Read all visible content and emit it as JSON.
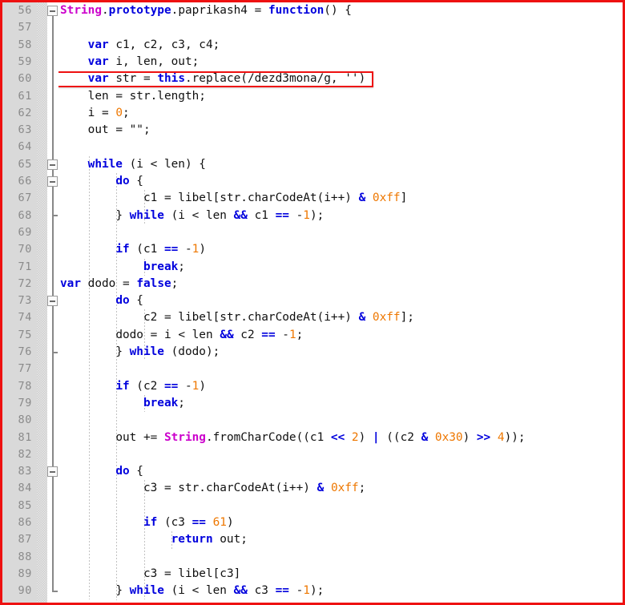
{
  "editor": {
    "language": "JavaScript",
    "first_line": 56,
    "last_line": 90,
    "line_height": 21.3,
    "colors": {
      "background": "#ffffff",
      "gutter_background": "#d9d9d9",
      "line_number": "#8a8a8a",
      "keyword": "#0000dd",
      "type": "#cc00cc",
      "number": "#ee7700",
      "text": "#101010",
      "highlight_border": "#ee1111",
      "fold_line": "#888888",
      "indent_guide": "#c2c2c2"
    },
    "highlight": {
      "line": 60,
      "text": "var str = this.replace(/dezd3mona/g, '')"
    },
    "fold_markers": [
      {
        "line": 56,
        "type": "open"
      },
      {
        "line": 65,
        "type": "open"
      },
      {
        "line": 66,
        "type": "open"
      },
      {
        "line": 68,
        "type": "end"
      },
      {
        "line": 73,
        "type": "open"
      },
      {
        "line": 76,
        "type": "end"
      },
      {
        "line": 83,
        "type": "open"
      },
      {
        "line": 90,
        "type": "end"
      }
    ],
    "line_numbers": [
      56,
      57,
      58,
      59,
      60,
      61,
      62,
      63,
      64,
      65,
      66,
      67,
      68,
      69,
      70,
      71,
      72,
      73,
      74,
      75,
      76,
      77,
      78,
      79,
      80,
      81,
      82,
      83,
      84,
      85,
      86,
      87,
      88,
      89,
      90
    ],
    "lines": [
      {
        "n": 56,
        "indent": 0,
        "tokens": [
          {
            "t": "String",
            "c": "typ"
          },
          {
            "t": ".",
            "c": "pun"
          },
          {
            "t": "prototype",
            "c": "kw"
          },
          {
            "t": ".",
            "c": "pun"
          },
          {
            "t": "paprikash4 ",
            "c": "pl"
          },
          {
            "t": "=",
            "c": "pun"
          },
          {
            "t": " ",
            "c": "pl"
          },
          {
            "t": "function",
            "c": "kw"
          },
          {
            "t": "() {",
            "c": "pun"
          }
        ]
      },
      {
        "n": 57,
        "indent": 0,
        "tokens": []
      },
      {
        "n": 58,
        "indent": 4,
        "tokens": [
          {
            "t": "var",
            "c": "kw"
          },
          {
            "t": " c1, c2, c3, c4;",
            "c": "pl"
          }
        ]
      },
      {
        "n": 59,
        "indent": 4,
        "tokens": [
          {
            "t": "var",
            "c": "kw"
          },
          {
            "t": " i, len, out;",
            "c": "pl"
          }
        ]
      },
      {
        "n": 60,
        "indent": 4,
        "tokens": [
          {
            "t": "var",
            "c": "kw"
          },
          {
            "t": " str ",
            "c": "pl"
          },
          {
            "t": "=",
            "c": "pun"
          },
          {
            "t": " ",
            "c": "pl"
          },
          {
            "t": "this",
            "c": "kw"
          },
          {
            "t": ".replace(/dezd3mona/g, '')",
            "c": "pl"
          }
        ]
      },
      {
        "n": 61,
        "indent": 4,
        "tokens": [
          {
            "t": "len ",
            "c": "pl"
          },
          {
            "t": "=",
            "c": "pun"
          },
          {
            "t": " str.length;",
            "c": "pl"
          }
        ]
      },
      {
        "n": 62,
        "indent": 4,
        "tokens": [
          {
            "t": "i ",
            "c": "pl"
          },
          {
            "t": "=",
            "c": "pun"
          },
          {
            "t": " ",
            "c": "pl"
          },
          {
            "t": "0",
            "c": "num"
          },
          {
            "t": ";",
            "c": "pun"
          }
        ]
      },
      {
        "n": 63,
        "indent": 4,
        "tokens": [
          {
            "t": "out ",
            "c": "pl"
          },
          {
            "t": "=",
            "c": "pun"
          },
          {
            "t": " \"\";",
            "c": "pl"
          }
        ]
      },
      {
        "n": 64,
        "indent": 0,
        "tokens": []
      },
      {
        "n": 65,
        "indent": 4,
        "tokens": [
          {
            "t": "while",
            "c": "kw"
          },
          {
            "t": " (i ",
            "c": "pl"
          },
          {
            "t": "<",
            "c": "pun"
          },
          {
            "t": " len) {",
            "c": "pl"
          }
        ]
      },
      {
        "n": 66,
        "indent": 8,
        "tokens": [
          {
            "t": "do",
            "c": "kw"
          },
          {
            "t": " {",
            "c": "pun"
          }
        ]
      },
      {
        "n": 67,
        "indent": 12,
        "tokens": [
          {
            "t": "c1 ",
            "c": "pl"
          },
          {
            "t": "=",
            "c": "pun"
          },
          {
            "t": " libel[str.charCodeAt(i++) ",
            "c": "pl"
          },
          {
            "t": "&",
            "c": "op"
          },
          {
            "t": " ",
            "c": "pl"
          },
          {
            "t": "0xff",
            "c": "num"
          },
          {
            "t": "]",
            "c": "pun"
          }
        ]
      },
      {
        "n": 68,
        "indent": 8,
        "tokens": [
          {
            "t": "} ",
            "c": "pun"
          },
          {
            "t": "while",
            "c": "kw"
          },
          {
            "t": " (i ",
            "c": "pl"
          },
          {
            "t": "<",
            "c": "pun"
          },
          {
            "t": " len ",
            "c": "pl"
          },
          {
            "t": "&&",
            "c": "op"
          },
          {
            "t": " c1 ",
            "c": "pl"
          },
          {
            "t": "==",
            "c": "op"
          },
          {
            "t": " ",
            "c": "pl"
          },
          {
            "t": "-",
            "c": "pun"
          },
          {
            "t": "1",
            "c": "num"
          },
          {
            "t": ");",
            "c": "pun"
          }
        ]
      },
      {
        "n": 69,
        "indent": 0,
        "tokens": []
      },
      {
        "n": 70,
        "indent": 8,
        "tokens": [
          {
            "t": "if",
            "c": "kw"
          },
          {
            "t": " (c1 ",
            "c": "pl"
          },
          {
            "t": "==",
            "c": "op"
          },
          {
            "t": " ",
            "c": "pl"
          },
          {
            "t": "-",
            "c": "pun"
          },
          {
            "t": "1",
            "c": "num"
          },
          {
            "t": ")",
            "c": "pun"
          }
        ]
      },
      {
        "n": 71,
        "indent": 12,
        "tokens": [
          {
            "t": "break",
            "c": "kw"
          },
          {
            "t": ";",
            "c": "pun"
          }
        ]
      },
      {
        "n": 72,
        "indent": 0,
        "tokens": [
          {
            "t": "var",
            "c": "kw"
          },
          {
            "t": " dodo ",
            "c": "pl"
          },
          {
            "t": "=",
            "c": "pun"
          },
          {
            "t": " ",
            "c": "pl"
          },
          {
            "t": "false",
            "c": "kw"
          },
          {
            "t": ";",
            "c": "pun"
          }
        ]
      },
      {
        "n": 73,
        "indent": 8,
        "tokens": [
          {
            "t": "do",
            "c": "kw"
          },
          {
            "t": " {",
            "c": "pun"
          }
        ]
      },
      {
        "n": 74,
        "indent": 12,
        "tokens": [
          {
            "t": "c2 ",
            "c": "pl"
          },
          {
            "t": "=",
            "c": "pun"
          },
          {
            "t": " libel[str.charCodeAt(i++) ",
            "c": "pl"
          },
          {
            "t": "&",
            "c": "op"
          },
          {
            "t": " ",
            "c": "pl"
          },
          {
            "t": "0xff",
            "c": "num"
          },
          {
            "t": "];",
            "c": "pun"
          }
        ]
      },
      {
        "n": 75,
        "indent": 8,
        "tokens": [
          {
            "t": "dodo ",
            "c": "pl"
          },
          {
            "t": "=",
            "c": "pun"
          },
          {
            "t": " i ",
            "c": "pl"
          },
          {
            "t": "<",
            "c": "pun"
          },
          {
            "t": " len ",
            "c": "pl"
          },
          {
            "t": "&&",
            "c": "op"
          },
          {
            "t": " c2 ",
            "c": "pl"
          },
          {
            "t": "==",
            "c": "op"
          },
          {
            "t": " ",
            "c": "pl"
          },
          {
            "t": "-",
            "c": "pun"
          },
          {
            "t": "1",
            "c": "num"
          },
          {
            "t": ";",
            "c": "pun"
          }
        ]
      },
      {
        "n": 76,
        "indent": 8,
        "tokens": [
          {
            "t": "} ",
            "c": "pun"
          },
          {
            "t": "while",
            "c": "kw"
          },
          {
            "t": " (dodo);",
            "c": "pl"
          }
        ]
      },
      {
        "n": 77,
        "indent": 0,
        "tokens": []
      },
      {
        "n": 78,
        "indent": 8,
        "tokens": [
          {
            "t": "if",
            "c": "kw"
          },
          {
            "t": " (c2 ",
            "c": "pl"
          },
          {
            "t": "==",
            "c": "op"
          },
          {
            "t": " ",
            "c": "pl"
          },
          {
            "t": "-",
            "c": "pun"
          },
          {
            "t": "1",
            "c": "num"
          },
          {
            "t": ")",
            "c": "pun"
          }
        ]
      },
      {
        "n": 79,
        "indent": 12,
        "tokens": [
          {
            "t": "break",
            "c": "kw"
          },
          {
            "t": ";",
            "c": "pun"
          }
        ]
      },
      {
        "n": 80,
        "indent": 0,
        "tokens": []
      },
      {
        "n": 81,
        "indent": 8,
        "tokens": [
          {
            "t": "out ",
            "c": "pl"
          },
          {
            "t": "+=",
            "c": "pun"
          },
          {
            "t": " ",
            "c": "pl"
          },
          {
            "t": "String",
            "c": "typ"
          },
          {
            "t": ".fromCharCode((c1 ",
            "c": "pl"
          },
          {
            "t": "<<",
            "c": "op"
          },
          {
            "t": " ",
            "c": "pl"
          },
          {
            "t": "2",
            "c": "num"
          },
          {
            "t": ") ",
            "c": "pun"
          },
          {
            "t": "|",
            "c": "op"
          },
          {
            "t": " ((c2 ",
            "c": "pl"
          },
          {
            "t": "&",
            "c": "op"
          },
          {
            "t": " ",
            "c": "pl"
          },
          {
            "t": "0x30",
            "c": "num"
          },
          {
            "t": ") ",
            "c": "pun"
          },
          {
            "t": ">>",
            "c": "op"
          },
          {
            "t": " ",
            "c": "pl"
          },
          {
            "t": "4",
            "c": "num"
          },
          {
            "t": "));",
            "c": "pun"
          }
        ]
      },
      {
        "n": 82,
        "indent": 0,
        "tokens": []
      },
      {
        "n": 83,
        "indent": 8,
        "tokens": [
          {
            "t": "do",
            "c": "kw"
          },
          {
            "t": " {",
            "c": "pun"
          }
        ]
      },
      {
        "n": 84,
        "indent": 12,
        "tokens": [
          {
            "t": "c3 ",
            "c": "pl"
          },
          {
            "t": "=",
            "c": "pun"
          },
          {
            "t": " str.charCodeAt(i++) ",
            "c": "pl"
          },
          {
            "t": "&",
            "c": "op"
          },
          {
            "t": " ",
            "c": "pl"
          },
          {
            "t": "0xff",
            "c": "num"
          },
          {
            "t": ";",
            "c": "pun"
          }
        ]
      },
      {
        "n": 85,
        "indent": 0,
        "tokens": []
      },
      {
        "n": 86,
        "indent": 12,
        "tokens": [
          {
            "t": "if",
            "c": "kw"
          },
          {
            "t": " (c3 ",
            "c": "pl"
          },
          {
            "t": "==",
            "c": "op"
          },
          {
            "t": " ",
            "c": "pl"
          },
          {
            "t": "61",
            "c": "num"
          },
          {
            "t": ")",
            "c": "pun"
          }
        ]
      },
      {
        "n": 87,
        "indent": 16,
        "tokens": [
          {
            "t": "return",
            "c": "kw"
          },
          {
            "t": " out;",
            "c": "pl"
          }
        ]
      },
      {
        "n": 88,
        "indent": 0,
        "tokens": []
      },
      {
        "n": 89,
        "indent": 12,
        "tokens": [
          {
            "t": "c3 ",
            "c": "pl"
          },
          {
            "t": "=",
            "c": "pun"
          },
          {
            "t": " libel[c3]",
            "c": "pl"
          }
        ]
      },
      {
        "n": 90,
        "indent": 8,
        "tokens": [
          {
            "t": "} ",
            "c": "pun"
          },
          {
            "t": "while",
            "c": "kw"
          },
          {
            "t": " (i ",
            "c": "pl"
          },
          {
            "t": "<",
            "c": "pun"
          },
          {
            "t": " len ",
            "c": "pl"
          },
          {
            "t": "&&",
            "c": "op"
          },
          {
            "t": " c3 ",
            "c": "pl"
          },
          {
            "t": "==",
            "c": "op"
          },
          {
            "t": " ",
            "c": "pl"
          },
          {
            "t": "-",
            "c": "pun"
          },
          {
            "t": "1",
            "c": "num"
          },
          {
            "t": ");",
            "c": "pun"
          }
        ]
      }
    ],
    "indent_guides": [
      {
        "indent": 4,
        "from_line": 65,
        "to_line": 90
      },
      {
        "indent": 8,
        "from_line": 66,
        "to_line": 90
      },
      {
        "indent": 12,
        "from_line": 67,
        "to_line": 68
      },
      {
        "indent": 12,
        "from_line": 71,
        "to_line": 71
      },
      {
        "indent": 12,
        "from_line": 74,
        "to_line": 76
      },
      {
        "indent": 12,
        "from_line": 79,
        "to_line": 79
      },
      {
        "indent": 12,
        "from_line": 84,
        "to_line": 90
      },
      {
        "indent": 16,
        "from_line": 87,
        "to_line": 87
      }
    ]
  }
}
